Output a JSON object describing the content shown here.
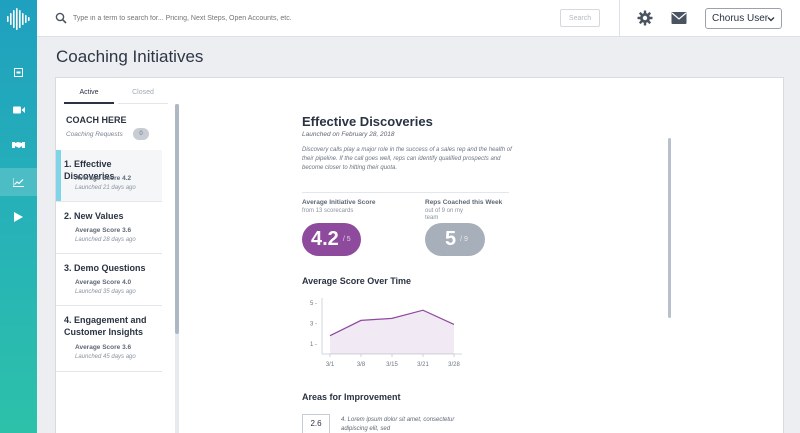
{
  "topbar": {
    "search_placeholder": "Type in a term to search for... Pricing, Next Steps, Open Accounts, etc.",
    "search_button": "Search",
    "user": "Chorus User"
  },
  "page": {
    "title": "Coaching Initiatives"
  },
  "tabs": [
    {
      "label": "Active",
      "selected": true
    },
    {
      "label": "Closed",
      "selected": false
    }
  ],
  "sidebar": {
    "coach_here": "COACH HERE",
    "coaching_requests_label": "Coaching Requests",
    "coaching_requests_count": "0",
    "initiatives": [
      {
        "title": "1. Effective Discoveries",
        "score": "Average Score 4.2",
        "ago": "Launched 21 days ago"
      },
      {
        "title": "2. New Values",
        "score": "Average Score 3.6",
        "ago": "Launched 28 days ago"
      },
      {
        "title": "3. Demo Questions",
        "score": "Average Score 4.0",
        "ago": "Launched 35 days ago"
      },
      {
        "title": "4. Engagement and Customer Insights",
        "score": "Average Score 3.6",
        "ago": "Launched 45 days ago"
      }
    ]
  },
  "detail": {
    "title": "Effective Discoveries",
    "launched": "Launched on February 28, 2018",
    "description": "Discovery calls play a major role in the success of a sales rep and the health of their pipeline. If the call goes well, reps can identify qualified prospects and become closer to hitting their quota.",
    "avg_label": "Average Initiative Score",
    "avg_sub": "from 13 scorecards",
    "avg_value": "4.2",
    "avg_denom": "/ 5",
    "reps_label": "Reps Coached this Week",
    "reps_sub": "out of 9 on my team",
    "reps_value": "5",
    "reps_denom": "/ 9",
    "chart_title": "Average Score Over Time",
    "areas_title": "Areas for Improvement",
    "area_score": "2.6",
    "area_text": "4.  Lorem ipsum dolor sit amet, consectetur adipiscing elit, sed"
  },
  "chart_data": {
    "type": "area",
    "title": "Average Score Over Time",
    "categories": [
      "3/1",
      "3/8",
      "3/15",
      "3/21",
      "3/28"
    ],
    "values": [
      1.8,
      3.3,
      3.5,
      4.3,
      2.9
    ],
    "ylim": [
      0,
      5.5
    ],
    "yticks": [
      "5 -",
      "3 -",
      "1 -"
    ],
    "ytick_values": [
      5,
      3,
      1
    ],
    "color": "#8e4a9c"
  },
  "colors": {
    "accent": "#8e4a9c",
    "nav": "#1fa0bf",
    "active_marker": "#80d4e8"
  }
}
